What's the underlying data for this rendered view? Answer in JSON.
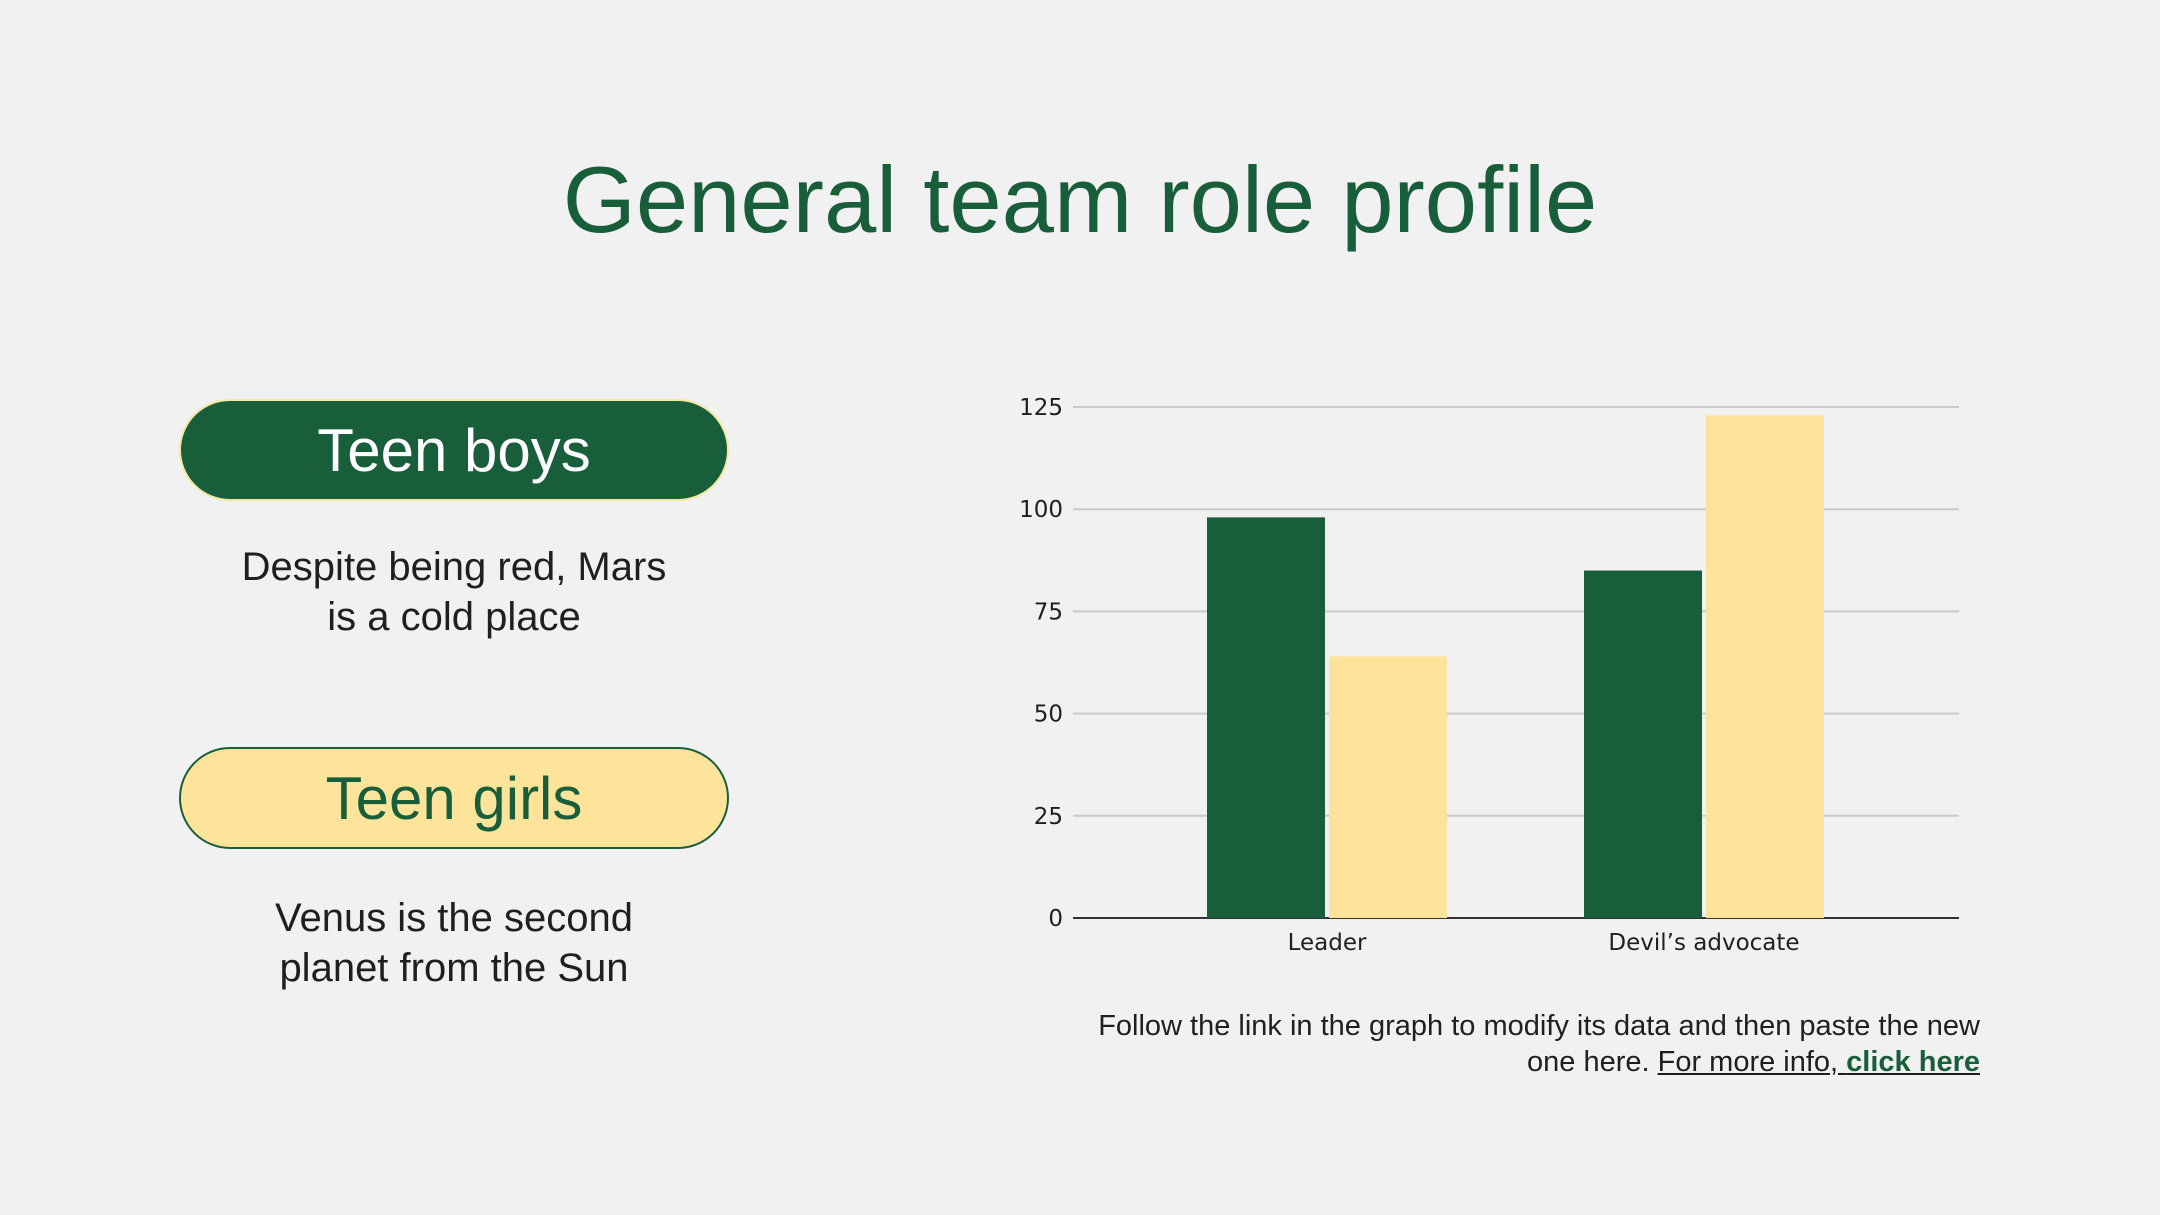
{
  "title": "General team role profile",
  "groups": [
    {
      "label": "Teen boys",
      "description_line1": "Despite being red, Mars",
      "description_line2": "is a cold place"
    },
    {
      "label": "Teen girls",
      "description_line1": "Venus is the second",
      "description_line2": "planet from the Sun"
    }
  ],
  "caption": {
    "line1": "Follow the link in the graph to modify its data and then paste the new",
    "line2_prefix": "one here. ",
    "link_text": "For more info, ",
    "link_bold": "click here"
  },
  "colors": {
    "dark_green": "#185e3a",
    "yellow": "#fee49a",
    "background": "#f1f1f1"
  },
  "chart_data": {
    "type": "bar",
    "categories": [
      "Leader",
      "Devil’s advocate"
    ],
    "series": [
      {
        "values": [
          98,
          85
        ],
        "color": "#185e3a"
      },
      {
        "values": [
          64,
          123
        ],
        "color": "#fee49a"
      }
    ],
    "ylim": [
      0,
      125
    ],
    "yticks": [
      0,
      25,
      50,
      75,
      100,
      125
    ],
    "grid": true
  }
}
